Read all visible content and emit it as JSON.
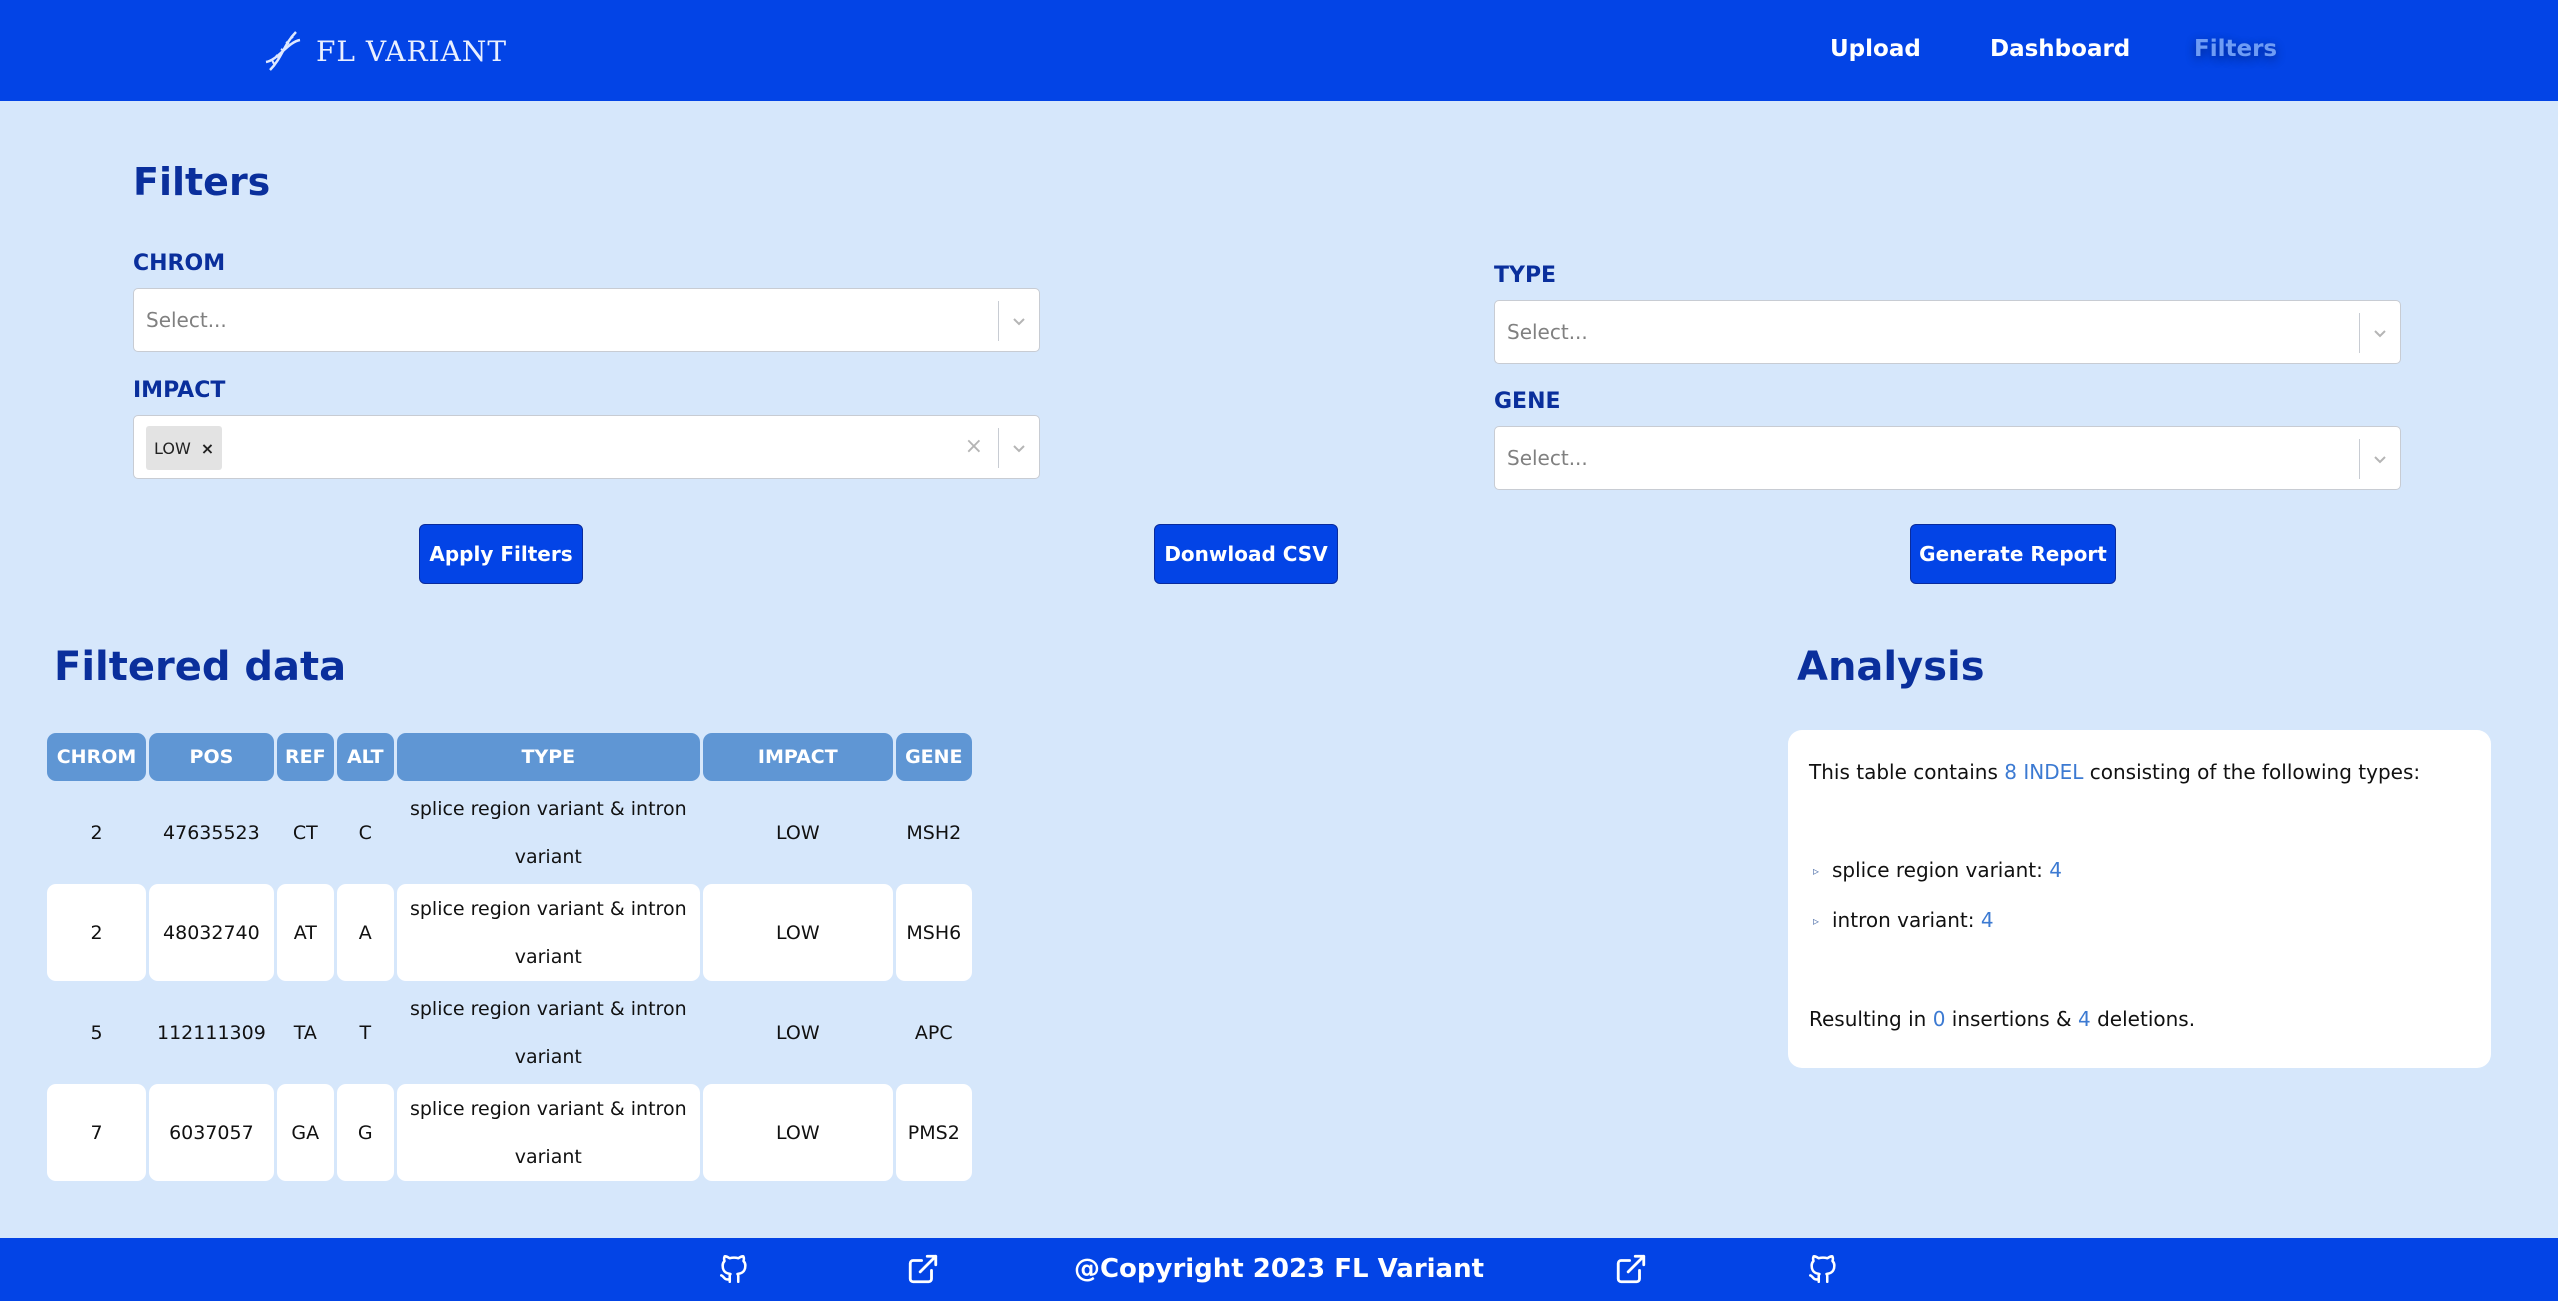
{
  "header": {
    "brand": "FL VARIANT",
    "nav": [
      {
        "label": "Upload"
      },
      {
        "label": "Dashboard"
      },
      {
        "label": "Filters"
      }
    ]
  },
  "filters": {
    "title": "Filters",
    "chrom": {
      "label": "CHROM",
      "placeholder": "Select..."
    },
    "impact": {
      "label": "IMPACT",
      "selected": [
        "LOW"
      ]
    },
    "type": {
      "label": "TYPE",
      "placeholder": "Select..."
    },
    "gene": {
      "label": "GENE",
      "placeholder": "Select..."
    },
    "buttons": {
      "apply": "Apply Filters",
      "download": "Donwload CSV",
      "report": "Generate Report"
    }
  },
  "filtered_data": {
    "title": "Filtered data",
    "columns": [
      "CHROM",
      "POS",
      "REF",
      "ALT",
      "TYPE",
      "IMPACT",
      "GENE"
    ],
    "rows": [
      [
        "2",
        "47635523",
        "CT",
        "C",
        "splice region variant & intron variant",
        "LOW",
        "MSH2"
      ],
      [
        "2",
        "48032740",
        "AT",
        "A",
        "splice region variant & intron variant",
        "LOW",
        "MSH6"
      ],
      [
        "5",
        "112111309",
        "TA",
        "T",
        "splice region variant & intron variant",
        "LOW",
        "APC"
      ],
      [
        "7",
        "6037057",
        "GA",
        "G",
        "splice region variant & intron variant",
        "LOW",
        "PMS2"
      ]
    ]
  },
  "analysis": {
    "title": "Analysis",
    "intro_prefix": "This table contains",
    "count_highlight": "8 INDEL",
    "intro_suffix": "consisting of the following types:",
    "types": [
      {
        "label": "splice region variant:",
        "count": "4"
      },
      {
        "label": "intron variant:",
        "count": "4"
      }
    ],
    "result_prefix": "Resulting in",
    "insertions": "0",
    "mid": "insertions &",
    "deletions": "4",
    "result_suffix": "deletions."
  },
  "footer": {
    "copyright": "@Copyright 2023 FL Variant",
    "icons": [
      "github-icon",
      "external-link-icon",
      "external-link-icon",
      "github-icon"
    ]
  },
  "colors": {
    "primary": "#0344e6",
    "background": "#d6e7fb",
    "heading": "#0a2f9c",
    "table_header": "#5f96d4",
    "highlight": "#3c7ad2"
  }
}
